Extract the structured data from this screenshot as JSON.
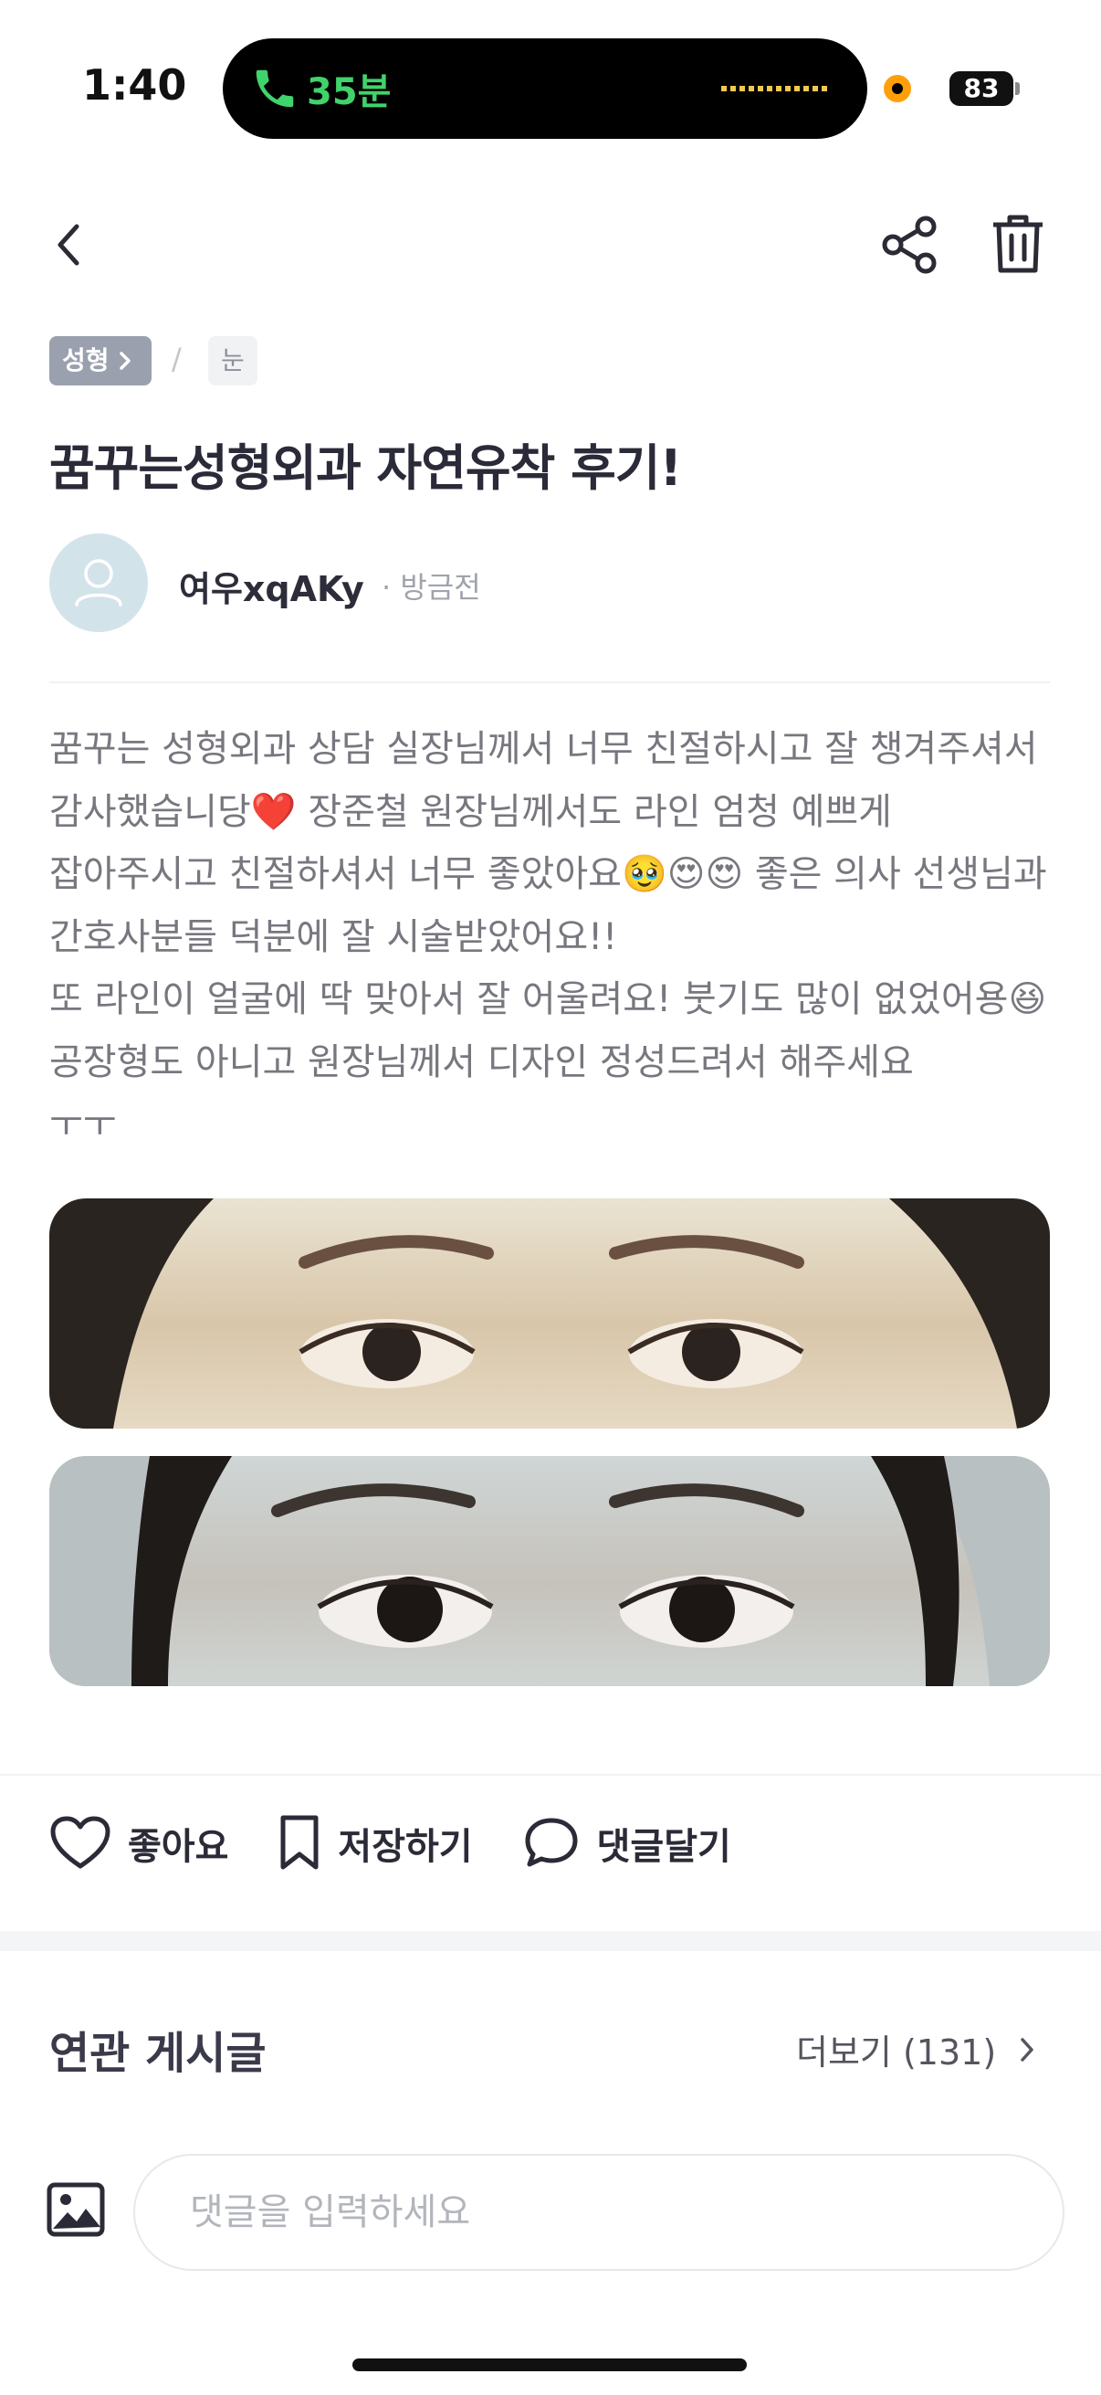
{
  "status_bar": {
    "time": "1:40",
    "call_duration": "35분",
    "battery": "83"
  },
  "header": {
    "back_icon": "chevron-left-icon",
    "share_icon": "share-icon",
    "trash_icon": "trash-icon"
  },
  "breadcrumb": {
    "category": "성형",
    "separator": "/",
    "subcategory": "눈"
  },
  "post": {
    "title": "꿈꾸는성형외과 자연유착 후기!",
    "author": "여우xqAKy",
    "time_ago": "· 방금전",
    "body": "꿈꾸는 성형외과 상담 실장님께서 너무 친절하시고 잘 챙겨주셔서 감사했습니당❤️ 장준철 원장님께서도 라인 엄청 예쁘게 잡아주시고 친절하셔서 너무 좋았아요🥹😍😍 좋은 의사 선생님과 간호사분들 덕분에 잘 시술받았어요!!\n또 라인이 얼굴에 딱 맞아서 잘 어울려요! 붓기도 많이 없었어용😆 공장형도 아니고 원장님께서 디자인 정성드려서 해주세요\nㅜㅜ"
  },
  "actions": {
    "like": "좋아요",
    "save": "저장하기",
    "comment": "댓글달기"
  },
  "related": {
    "title": "연관 게시글",
    "more": "더보기 (131)"
  },
  "comment": {
    "placeholder": "댓글을 입력하세요"
  },
  "colors": {
    "accent_green": "#41d36b",
    "text_dark": "#2a2a38",
    "text_muted": "#77777f"
  }
}
